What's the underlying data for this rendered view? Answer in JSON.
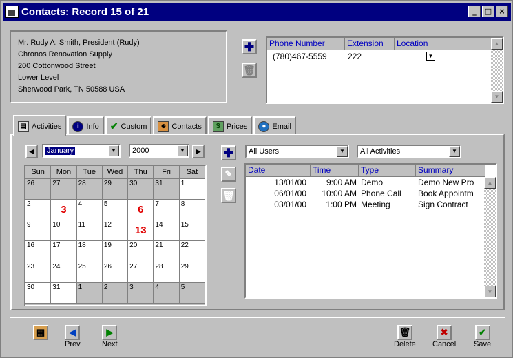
{
  "window": {
    "title": "Contacts: Record 15 of 21",
    "controls": [
      "_",
      "□",
      "×"
    ]
  },
  "address": {
    "lines": [
      "Mr. Rudy A. Smith, President (Rudy)",
      "Chronos Renovation Supply",
      "200 Cottonwood Street",
      "Lower Level",
      "Sherwood Park, TN 50588  USA"
    ]
  },
  "phones": {
    "columns": [
      "Phone Number",
      "Extension",
      "Location"
    ],
    "rows": [
      {
        "number": "(780)467-5559",
        "extension": "222",
        "location": ""
      }
    ]
  },
  "tabs": [
    {
      "label": "Activities",
      "icon": "activities-icon",
      "active": true
    },
    {
      "label": "Info",
      "icon": "info-icon"
    },
    {
      "label": "Custom",
      "icon": "checkmark-icon"
    },
    {
      "label": "Contacts",
      "icon": "people-icon"
    },
    {
      "label": "Prices",
      "icon": "money-icon"
    },
    {
      "label": "Email",
      "icon": "globe-icon"
    }
  ],
  "calendar": {
    "month": "January",
    "year": "2000",
    "weekdays": [
      "Sun",
      "Mon",
      "Tue",
      "Wed",
      "Thu",
      "Fri",
      "Sat"
    ],
    "weeks": [
      [
        "26",
        "27",
        "28",
        "29",
        "30",
        "31",
        "1"
      ],
      [
        "2",
        "3",
        "4",
        "5",
        "6",
        "7",
        "8"
      ],
      [
        "9",
        "10",
        "11",
        "12",
        "13",
        "14",
        "15"
      ],
      [
        "16",
        "17",
        "18",
        "19",
        "20",
        "21",
        "22"
      ],
      [
        "23",
        "24",
        "25",
        "26",
        "27",
        "28",
        "29"
      ],
      [
        "30",
        "31",
        "1",
        "2",
        "3",
        "4",
        "5"
      ]
    ],
    "highlighted": [
      "3",
      "6",
      "13"
    ]
  },
  "filters": {
    "users": "All Users",
    "activities": "All Activities"
  },
  "activities": {
    "columns": [
      "Date",
      "Time",
      "Type",
      "Summary"
    ],
    "rows": [
      {
        "date": "13/01/00",
        "time": "9:00 AM",
        "type": "Demo",
        "summary": "Demo New Pro"
      },
      {
        "date": "06/01/00",
        "time": "10:00 AM",
        "type": "Phone Call",
        "summary": "Book Appointm"
      },
      {
        "date": "03/01/00",
        "time": "1:00 PM",
        "type": "Meeting",
        "summary": "Sign Contract"
      }
    ]
  },
  "toolbar": {
    "prev": "Prev",
    "next": "Next",
    "delete": "Delete",
    "cancel": "Cancel",
    "save": "Save"
  },
  "colors": {
    "titlebar": "#000080",
    "link": "#0000c0",
    "highlight": "#e00000"
  }
}
